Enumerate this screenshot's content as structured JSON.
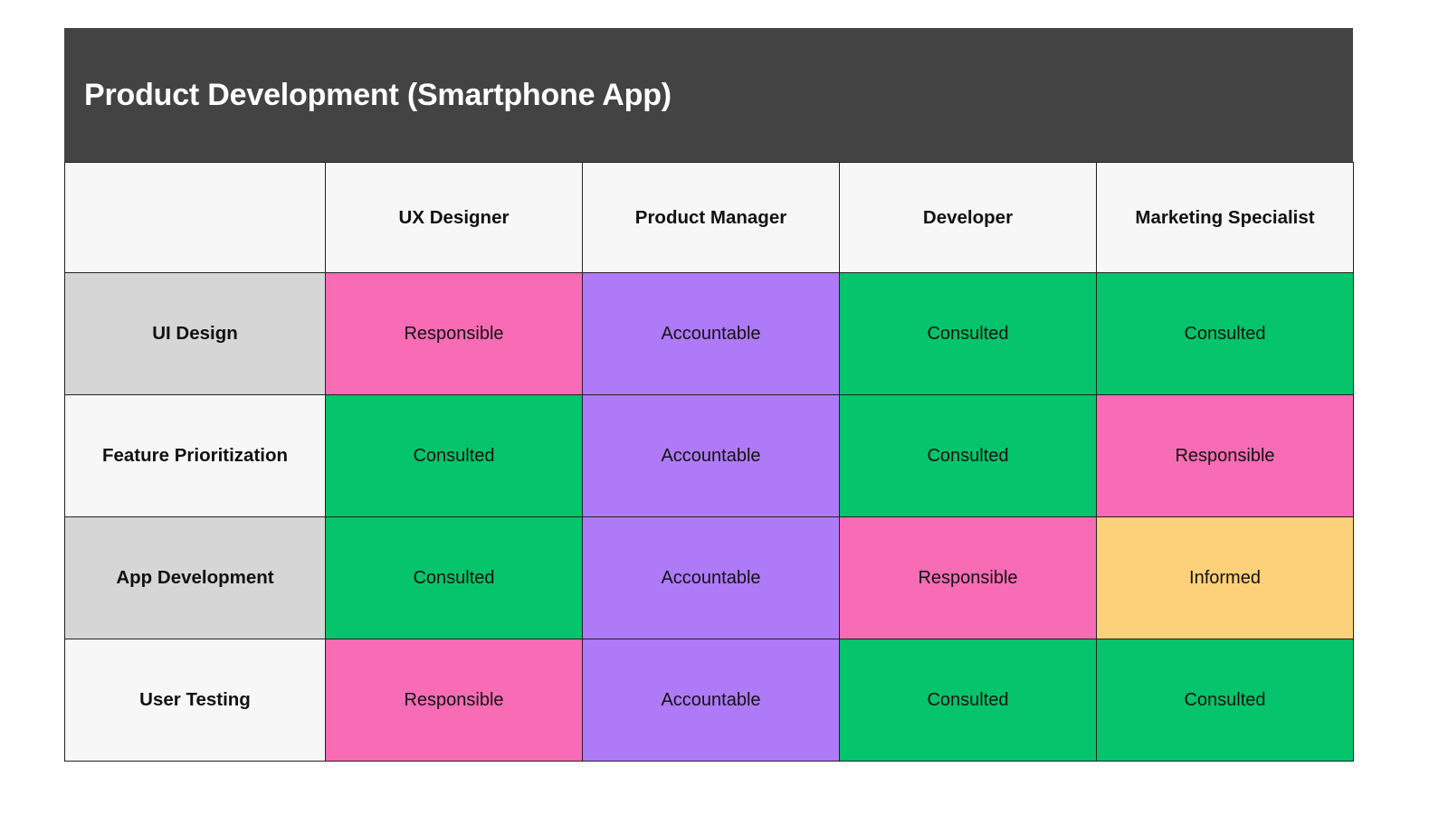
{
  "title": "Product Development (Smartphone App)",
  "table": {
    "corner_label": "",
    "columns": [
      "UX Designer",
      "Product Manager",
      "Developer",
      "Marketing Specialist"
    ],
    "rows": [
      {
        "task": "UI Design",
        "label_shade": "gray",
        "cells": [
          {
            "value": "Responsible",
            "code": "R"
          },
          {
            "value": "Accountable",
            "code": "A"
          },
          {
            "value": "Consulted",
            "code": "C"
          },
          {
            "value": "Consulted",
            "code": "C"
          }
        ]
      },
      {
        "task": "Feature Prioritization",
        "label_shade": "light",
        "cells": [
          {
            "value": "Consulted",
            "code": "C"
          },
          {
            "value": "Accountable",
            "code": "A"
          },
          {
            "value": "Consulted",
            "code": "C"
          },
          {
            "value": "Responsible",
            "code": "R"
          }
        ]
      },
      {
        "task": "App Development",
        "label_shade": "gray",
        "cells": [
          {
            "value": "Consulted",
            "code": "C"
          },
          {
            "value": "Accountable",
            "code": "A"
          },
          {
            "value": "Responsible",
            "code": "R"
          },
          {
            "value": "Informed",
            "code": "I"
          }
        ]
      },
      {
        "task": "User Testing",
        "label_shade": "light",
        "cells": [
          {
            "value": "Responsible",
            "code": "R"
          },
          {
            "value": "Accountable",
            "code": "A"
          },
          {
            "value": "Consulted",
            "code": "C"
          },
          {
            "value": "Consulted",
            "code": "C"
          }
        ]
      }
    ]
  },
  "colors": {
    "title_bar": "#434343",
    "responsible": "#f76cb4",
    "accountable": "#ae7af8",
    "consulted": "#05c46b",
    "informed": "#fcd179",
    "row_label_gray": "#d6d6d6",
    "row_label_light": "#f7f7f7",
    "header_background": "#f7f7f7",
    "border": "#222222"
  }
}
